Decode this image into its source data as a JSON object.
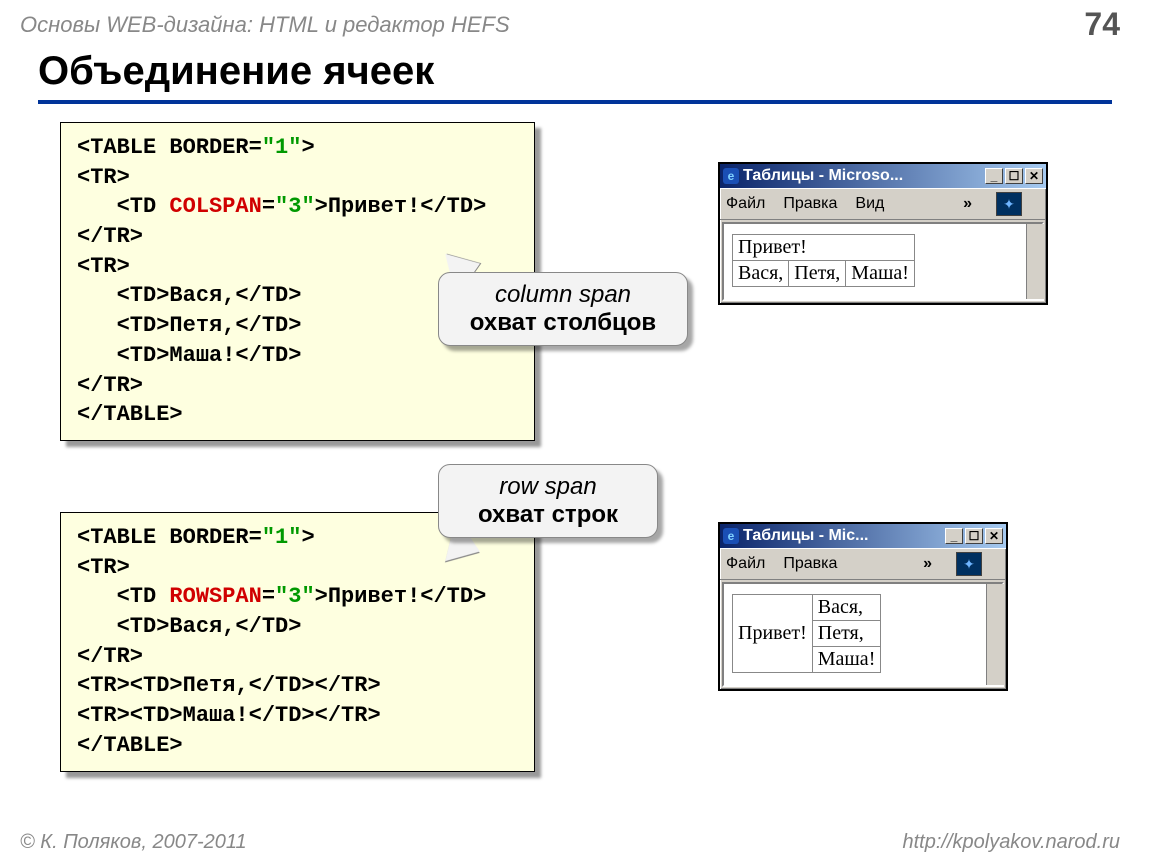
{
  "header": {
    "course_title": "Основы WEB-дизайна: HTML и редактор HEFS",
    "page": "74"
  },
  "title": "Объединение ячеек",
  "code1": "<TABLE BORDER=\"1\">\n<TR>\n   <TD COLSPAN=\"3\">Привет!</TD>\n</TR>\n<TR>\n   <TD>Вася,</TD>\n   <TD>Петя,</TD>\n   <TD>Маша!</TD>\n</TR>\n</TABLE>",
  "code2": "<TABLE BORDER=\"1\">\n<TR>\n   <TD ROWSPAN=\"3\">Привет!</TD>\n   <TD>Вася,</TD>\n</TR>\n<TR><TD>Петя,</TD></TR>\n<TR><TD>Маша!</TD></TR>\n</TABLE>",
  "callout1": {
    "line1": "column span",
    "line2": "охват столбцов"
  },
  "callout2": {
    "line1": "row span",
    "line2": "охват строк"
  },
  "win1": {
    "title": "Таблицы - Microso...",
    "menu": [
      "Файл",
      "Правка",
      "Вид"
    ],
    "table": {
      "row1": "Привет!",
      "row2": [
        "Вася,",
        "Петя,",
        "Маша!"
      ]
    }
  },
  "win2": {
    "title": "Таблицы - Mic...",
    "menu": [
      "Файл",
      "Правка"
    ],
    "table": {
      "colcell": "Привет!",
      "rows": [
        "Вася,",
        "Петя,",
        "Маша!"
      ]
    }
  },
  "footer": {
    "left": "© К. Поляков, 2007-2011",
    "right": "http://kpolyakov.narod.ru"
  }
}
